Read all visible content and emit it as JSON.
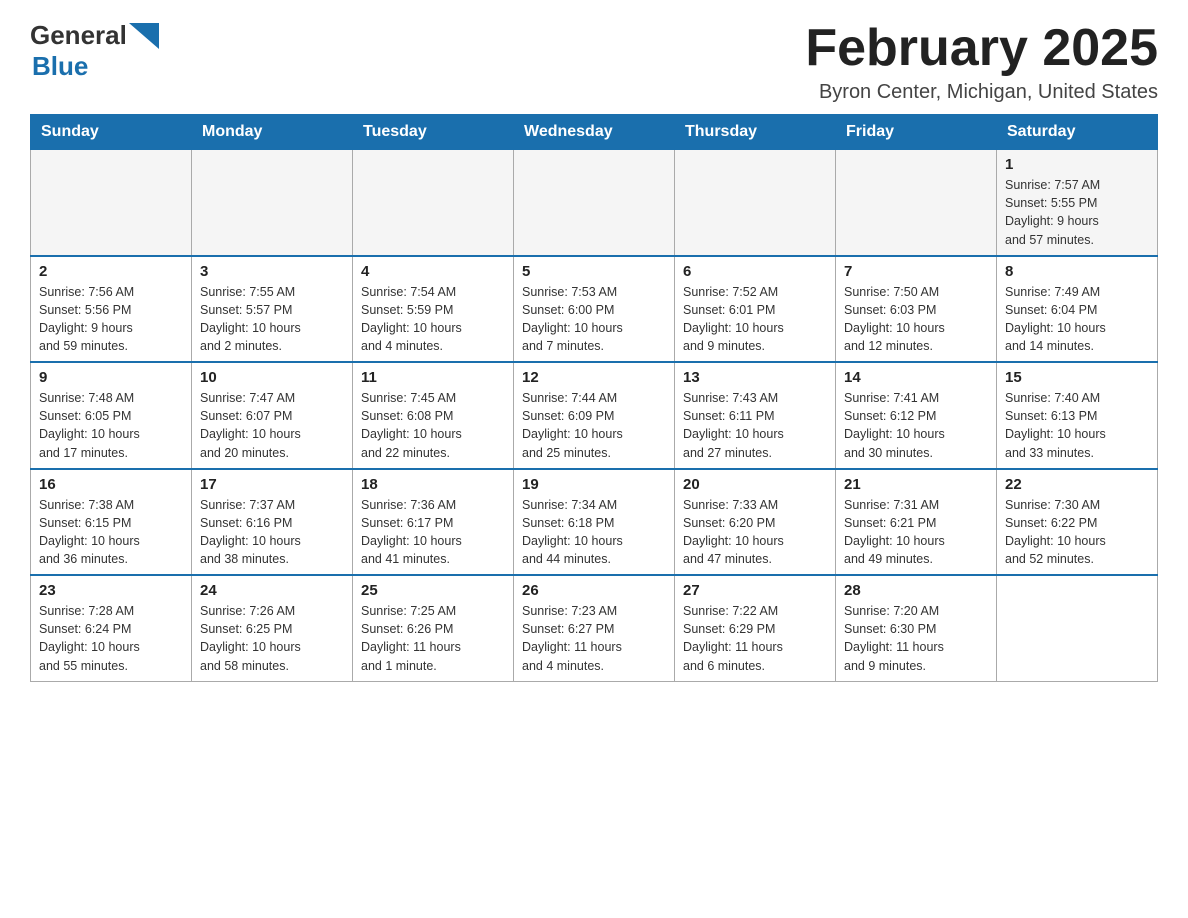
{
  "header": {
    "logo_general": "General",
    "logo_blue": "Blue",
    "month_title": "February 2025",
    "location": "Byron Center, Michigan, United States"
  },
  "days_of_week": [
    "Sunday",
    "Monday",
    "Tuesday",
    "Wednesday",
    "Thursday",
    "Friday",
    "Saturday"
  ],
  "weeks": [
    [
      {
        "day": "",
        "info": ""
      },
      {
        "day": "",
        "info": ""
      },
      {
        "day": "",
        "info": ""
      },
      {
        "day": "",
        "info": ""
      },
      {
        "day": "",
        "info": ""
      },
      {
        "day": "",
        "info": ""
      },
      {
        "day": "1",
        "info": "Sunrise: 7:57 AM\nSunset: 5:55 PM\nDaylight: 9 hours\nand 57 minutes."
      }
    ],
    [
      {
        "day": "2",
        "info": "Sunrise: 7:56 AM\nSunset: 5:56 PM\nDaylight: 9 hours\nand 59 minutes."
      },
      {
        "day": "3",
        "info": "Sunrise: 7:55 AM\nSunset: 5:57 PM\nDaylight: 10 hours\nand 2 minutes."
      },
      {
        "day": "4",
        "info": "Sunrise: 7:54 AM\nSunset: 5:59 PM\nDaylight: 10 hours\nand 4 minutes."
      },
      {
        "day": "5",
        "info": "Sunrise: 7:53 AM\nSunset: 6:00 PM\nDaylight: 10 hours\nand 7 minutes."
      },
      {
        "day": "6",
        "info": "Sunrise: 7:52 AM\nSunset: 6:01 PM\nDaylight: 10 hours\nand 9 minutes."
      },
      {
        "day": "7",
        "info": "Sunrise: 7:50 AM\nSunset: 6:03 PM\nDaylight: 10 hours\nand 12 minutes."
      },
      {
        "day": "8",
        "info": "Sunrise: 7:49 AM\nSunset: 6:04 PM\nDaylight: 10 hours\nand 14 minutes."
      }
    ],
    [
      {
        "day": "9",
        "info": "Sunrise: 7:48 AM\nSunset: 6:05 PM\nDaylight: 10 hours\nand 17 minutes."
      },
      {
        "day": "10",
        "info": "Sunrise: 7:47 AM\nSunset: 6:07 PM\nDaylight: 10 hours\nand 20 minutes."
      },
      {
        "day": "11",
        "info": "Sunrise: 7:45 AM\nSunset: 6:08 PM\nDaylight: 10 hours\nand 22 minutes."
      },
      {
        "day": "12",
        "info": "Sunrise: 7:44 AM\nSunset: 6:09 PM\nDaylight: 10 hours\nand 25 minutes."
      },
      {
        "day": "13",
        "info": "Sunrise: 7:43 AM\nSunset: 6:11 PM\nDaylight: 10 hours\nand 27 minutes."
      },
      {
        "day": "14",
        "info": "Sunrise: 7:41 AM\nSunset: 6:12 PM\nDaylight: 10 hours\nand 30 minutes."
      },
      {
        "day": "15",
        "info": "Sunrise: 7:40 AM\nSunset: 6:13 PM\nDaylight: 10 hours\nand 33 minutes."
      }
    ],
    [
      {
        "day": "16",
        "info": "Sunrise: 7:38 AM\nSunset: 6:15 PM\nDaylight: 10 hours\nand 36 minutes."
      },
      {
        "day": "17",
        "info": "Sunrise: 7:37 AM\nSunset: 6:16 PM\nDaylight: 10 hours\nand 38 minutes."
      },
      {
        "day": "18",
        "info": "Sunrise: 7:36 AM\nSunset: 6:17 PM\nDaylight: 10 hours\nand 41 minutes."
      },
      {
        "day": "19",
        "info": "Sunrise: 7:34 AM\nSunset: 6:18 PM\nDaylight: 10 hours\nand 44 minutes."
      },
      {
        "day": "20",
        "info": "Sunrise: 7:33 AM\nSunset: 6:20 PM\nDaylight: 10 hours\nand 47 minutes."
      },
      {
        "day": "21",
        "info": "Sunrise: 7:31 AM\nSunset: 6:21 PM\nDaylight: 10 hours\nand 49 minutes."
      },
      {
        "day": "22",
        "info": "Sunrise: 7:30 AM\nSunset: 6:22 PM\nDaylight: 10 hours\nand 52 minutes."
      }
    ],
    [
      {
        "day": "23",
        "info": "Sunrise: 7:28 AM\nSunset: 6:24 PM\nDaylight: 10 hours\nand 55 minutes."
      },
      {
        "day": "24",
        "info": "Sunrise: 7:26 AM\nSunset: 6:25 PM\nDaylight: 10 hours\nand 58 minutes."
      },
      {
        "day": "25",
        "info": "Sunrise: 7:25 AM\nSunset: 6:26 PM\nDaylight: 11 hours\nand 1 minute."
      },
      {
        "day": "26",
        "info": "Sunrise: 7:23 AM\nSunset: 6:27 PM\nDaylight: 11 hours\nand 4 minutes."
      },
      {
        "day": "27",
        "info": "Sunrise: 7:22 AM\nSunset: 6:29 PM\nDaylight: 11 hours\nand 6 minutes."
      },
      {
        "day": "28",
        "info": "Sunrise: 7:20 AM\nSunset: 6:30 PM\nDaylight: 11 hours\nand 9 minutes."
      },
      {
        "day": "",
        "info": ""
      }
    ]
  ]
}
